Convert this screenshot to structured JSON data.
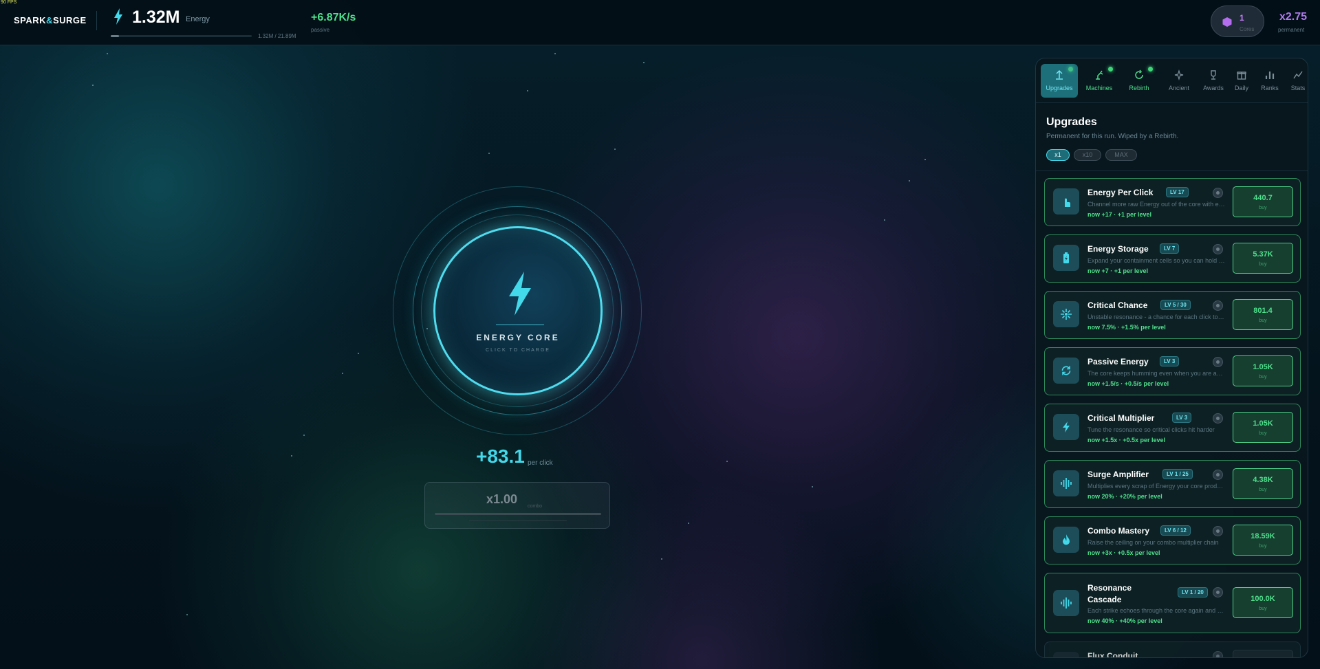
{
  "fps": "90 FPS",
  "brand": {
    "left": "SPARK",
    "amp": "&",
    "right": "SURGE"
  },
  "energy": {
    "value": "1.32M",
    "label": "Energy",
    "capacity": "1.32M / 21.89M",
    "fill_fraction": 0.06
  },
  "passive": {
    "value": "+6.87K/s",
    "label": "passive"
  },
  "cores": {
    "count": "1",
    "label": "Cores",
    "color": "#c27cf5"
  },
  "multiplier": {
    "value": "x2.75",
    "label": "permanent"
  },
  "core": {
    "title": "ENERGY CORE",
    "subtitle": "CLICK TO CHARGE",
    "accent": "#43d8ea"
  },
  "per_click": {
    "value": "+83.1",
    "label": "per click"
  },
  "combo": {
    "value": "x1.00",
    "label": "combo"
  },
  "tabs": [
    {
      "label": "Upgrades",
      "icon": "upgrade-arrow-icon",
      "active": true,
      "dot": true
    },
    {
      "label": "Machines",
      "icon": "robot-arm-icon",
      "active": false,
      "dot": true
    },
    {
      "label": "Rebirth",
      "icon": "rebirth-cycle-icon",
      "active": false,
      "dot": true
    },
    {
      "label": "Ancient",
      "icon": "sparkle-icon",
      "active": false,
      "dot": false
    },
    {
      "label": "Awards",
      "icon": "trophy-icon",
      "active": false,
      "dot": false
    },
    {
      "label": "Daily",
      "icon": "gift-icon",
      "active": false,
      "dot": false
    },
    {
      "label": "Ranks",
      "icon": "bar-chart-icon",
      "active": false,
      "dot": false
    },
    {
      "label": "Stats",
      "icon": "stats-line-icon",
      "active": false,
      "dot": false
    }
  ],
  "panel": {
    "title": "Upgrades",
    "subtitle": "Permanent for this run. Wiped by a Rebirth.",
    "qty": [
      "x1",
      "x10",
      "MAX"
    ]
  },
  "upgrades": [
    {
      "name": "Energy Per Click",
      "level": "LV 17",
      "desc": "Channel more raw Energy out of the core with every click",
      "effect": "now +17 · +1 per level",
      "price": "440.7",
      "buy": "buy",
      "icon": "pointer-hand-icon"
    },
    {
      "name": "Energy Storage",
      "level": "LV 7",
      "desc": "Expand your containment cells so you can hold more",
      "effect": "now +7 · +1 per level",
      "price": "5.37K",
      "buy": "buy",
      "icon": "battery-icon"
    },
    {
      "name": "Critical Chance",
      "level": "LV 5 / 30",
      "desc": "Unstable resonance - a chance for each click to crit",
      "effect": "now 7.5% · +1.5% per level",
      "price": "801.4",
      "buy": "buy",
      "icon": "crit-burst-icon"
    },
    {
      "name": "Passive Energy",
      "level": "LV 3",
      "desc": "The core keeps humming even when you are away",
      "effect": "now +1.5/s · +0.5/s per level",
      "price": "1.05K",
      "buy": "buy",
      "icon": "refresh-cycle-icon"
    },
    {
      "name": "Critical Multiplier",
      "level": "LV 3",
      "desc": "Tune the resonance so critical clicks hit harder",
      "effect": "now +1.5x · +0.5x per level",
      "price": "1.05K",
      "buy": "buy",
      "icon": "bolt-icon"
    },
    {
      "name": "Surge Amplifier",
      "level": "LV 1 / 25",
      "desc": "Multiplies every scrap of Energy your core produces",
      "effect": "now 20% · +20% per level",
      "price": "4.38K",
      "buy": "buy",
      "icon": "waveform-icon"
    },
    {
      "name": "Combo Mastery",
      "level": "LV 6 / 12",
      "desc": "Raise the ceiling on your combo multiplier chain",
      "effect": "now +3x · +0.5x per level",
      "price": "18.59K",
      "buy": "buy",
      "icon": "flame-icon"
    },
    {
      "name": "Resonance Cascade",
      "level": "LV 1 / 20",
      "desc": "Each strike echoes through the core again and again",
      "effect": "now 40% · +40% per level",
      "price": "100.0K",
      "buy": "buy",
      "icon": "waveform-icon"
    },
    {
      "name": "Flux Conduit",
      "level": "",
      "desc": "",
      "effect": "",
      "price": "",
      "buy": "",
      "icon": "conduit-icon"
    }
  ]
}
